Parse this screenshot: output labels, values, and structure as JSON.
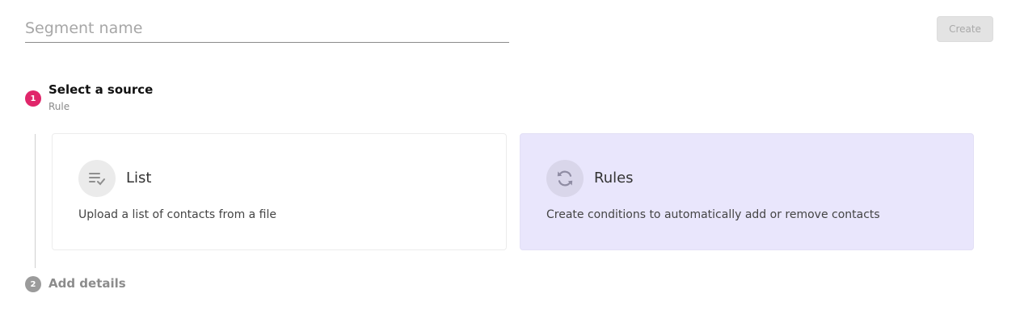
{
  "form": {
    "segment_name_placeholder": "Segment name",
    "segment_name_value": "",
    "create_label": "Create"
  },
  "steps": [
    {
      "number": "1",
      "title": "Select a source",
      "subtitle": "Rule",
      "color": "#e0266a"
    },
    {
      "number": "2",
      "title": "Add details",
      "color": "#9b9b9b"
    }
  ],
  "sources": [
    {
      "icon": "list-check-icon",
      "title": "List",
      "description": "Upload a list of contacts from a file"
    },
    {
      "icon": "refresh-icon",
      "title": "Rules",
      "description": "Create conditions to automatically add or remove contacts",
      "selected": true
    }
  ],
  "colors": {
    "accent": "#e0266a",
    "selected_card_bg": "#e9e6fc"
  }
}
